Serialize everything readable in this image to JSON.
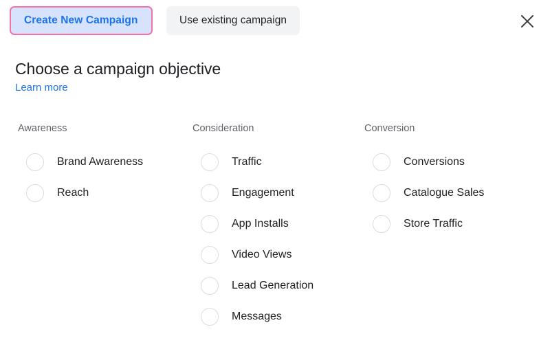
{
  "dialog": {
    "tabs": [
      {
        "label": "Create New Campaign",
        "selected": true
      },
      {
        "label": "Use existing campaign",
        "selected": false
      }
    ],
    "close_label": "Close",
    "close_icon": "close-icon"
  },
  "header": {
    "title": "Choose a campaign objective",
    "learn_more": "Learn more"
  },
  "colors": {
    "accent_blue": "#1a73e8",
    "selected_tab_bg": "#d7e3fc",
    "selected_tab_border": "#f472a6",
    "unselected_tab_bg": "#f1f3f4",
    "column_header_text": "#5f6368",
    "body_text": "#202124",
    "radio_border": "#dadce0",
    "page_bg": "#ffffff"
  },
  "columns": [
    {
      "header": "Awareness",
      "options": [
        {
          "label": "Brand Awareness",
          "selected": false
        },
        {
          "label": "Reach",
          "selected": false
        }
      ]
    },
    {
      "header": "Consideration",
      "options": [
        {
          "label": "Traffic",
          "selected": false
        },
        {
          "label": "Engagement",
          "selected": false
        },
        {
          "label": "App Installs",
          "selected": false
        },
        {
          "label": "Video Views",
          "selected": false
        },
        {
          "label": "Lead Generation",
          "selected": false
        },
        {
          "label": "Messages",
          "selected": false
        }
      ]
    },
    {
      "header": "Conversion",
      "options": [
        {
          "label": "Conversions",
          "selected": false
        },
        {
          "label": "Catalogue Sales",
          "selected": false
        },
        {
          "label": "Store Traffic",
          "selected": false
        }
      ]
    }
  ]
}
